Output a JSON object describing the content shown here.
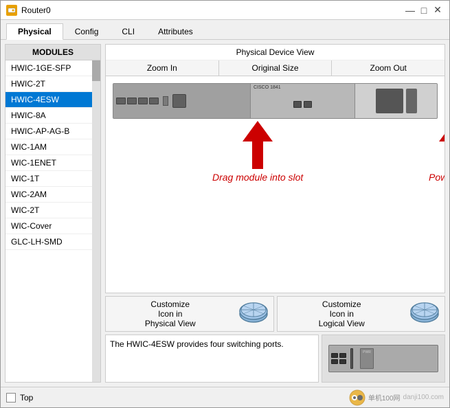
{
  "window": {
    "title": "Router0",
    "title_icon": "router-icon"
  },
  "title_controls": {
    "minimize": "—",
    "maximize": "□",
    "close": "✕"
  },
  "tabs": [
    {
      "label": "Physical",
      "active": true
    },
    {
      "label": "Config",
      "active": false
    },
    {
      "label": "CLI",
      "active": false
    },
    {
      "label": "Attributes",
      "active": false
    }
  ],
  "modules": {
    "header": "MODULES",
    "items": [
      {
        "label": "HWIC-1GE-SFP",
        "selected": false
      },
      {
        "label": "HWIC-2T",
        "selected": false
      },
      {
        "label": "HWIC-4ESW",
        "selected": true
      },
      {
        "label": "HWIC-8A",
        "selected": false
      },
      {
        "label": "HWIC-AP-AG-B",
        "selected": false
      },
      {
        "label": "WIC-1AM",
        "selected": false
      },
      {
        "label": "WIC-1ENET",
        "selected": false
      },
      {
        "label": "WIC-1T",
        "selected": false
      },
      {
        "label": "WIC-2AM",
        "selected": false
      },
      {
        "label": "WIC-2T",
        "selected": false
      },
      {
        "label": "WIC-Cover",
        "selected": false
      },
      {
        "label": "GLC-LH-SMD",
        "selected": false
      }
    ]
  },
  "device_view": {
    "title": "Physical Device View",
    "zoom_in": "Zoom In",
    "original_size": "Original Size",
    "zoom_out": "Zoom Out"
  },
  "annotations": {
    "drag_text": "Drag module into slot",
    "power_text": "Power is off"
  },
  "customize": {
    "physical_label": "Customize\nIcon in\nPhysical View",
    "logical_label": "Customize\nIcon in\nLogical View"
  },
  "info": {
    "description": "The HWIC-4ESW provides four switching ports."
  },
  "bottom_bar": {
    "checkbox_label": "Top"
  },
  "watermark": {
    "site": "danji100.com",
    "logo_text": "单机100网"
  }
}
